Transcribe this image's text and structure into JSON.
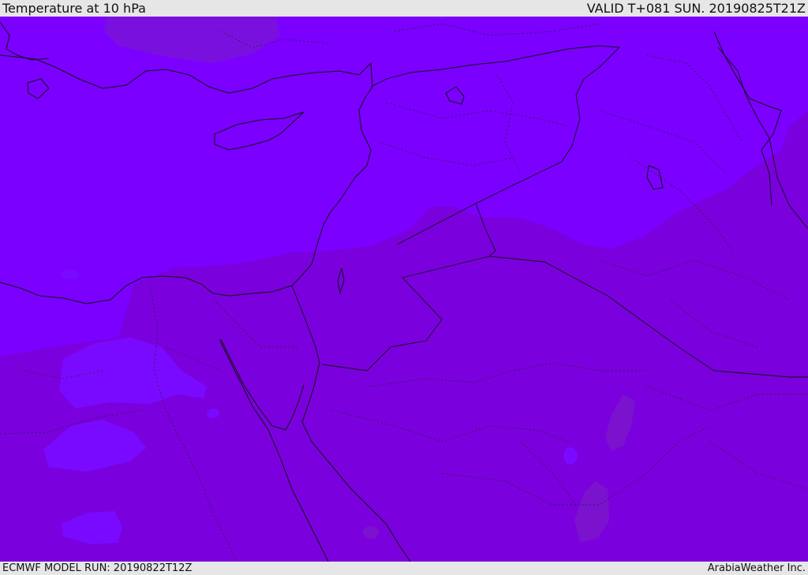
{
  "header": {
    "title": "Temperature at 10 hPa",
    "valid_time": "VALID T+081 SUN. 20190825T21Z"
  },
  "footer": {
    "model_run": "ECMWF MODEL RUN: 20190822T12Z",
    "credit": "ArabiaWeather Inc."
  },
  "colors": {
    "bar_background": "#e6e6e6",
    "temp_zone_violet": "#7b00ff",
    "temp_zone_purple": "#7a00dd",
    "temp_zone_light_patch": "#7a0aff",
    "temp_zone_dark_patch": "#7a1ac8",
    "boundary_lines": "#111111"
  }
}
